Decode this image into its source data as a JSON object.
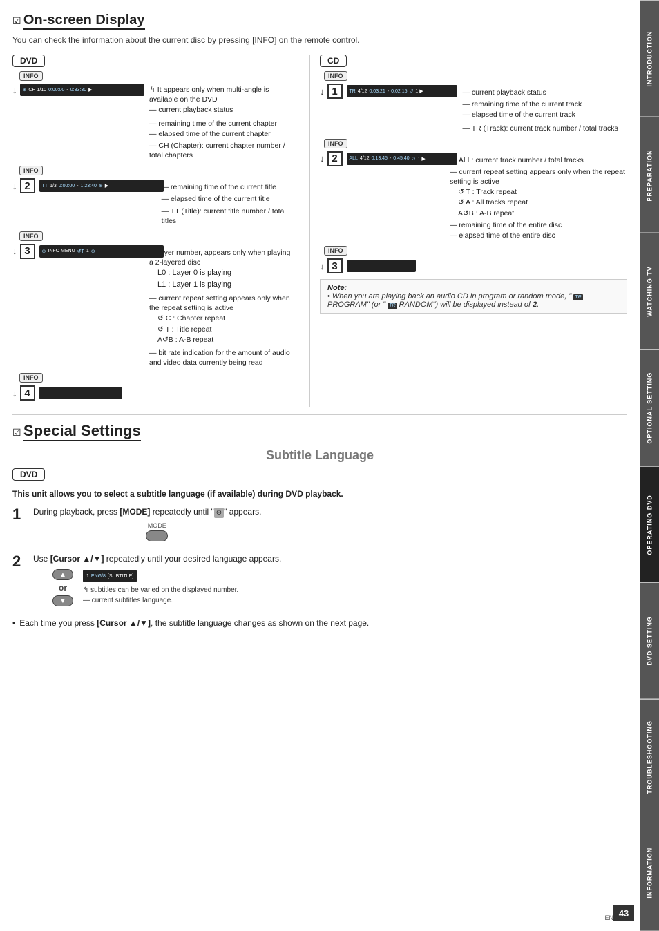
{
  "sidebar": {
    "tabs": [
      {
        "label": "INTRODUCTION",
        "active": false
      },
      {
        "label": "PREPARATION",
        "active": false
      },
      {
        "label": "WATCHING TV",
        "active": false
      },
      {
        "label": "OPTIONAL SETTING",
        "active": false
      },
      {
        "label": "OPERATING DVD",
        "active": true
      },
      {
        "label": "DVD SETTING",
        "active": false
      },
      {
        "label": "TROUBLESHOOTING",
        "active": false
      },
      {
        "label": "INFORMATION",
        "active": false
      }
    ]
  },
  "osd_section": {
    "title": "On-screen Display",
    "checkbox": "☑",
    "subtitle": "You can check the information about the current disc by pressing [INFO] on the remote control.",
    "dvd_badge": "DVD",
    "cd_badge": "CD",
    "dvd_display1": "CH 1/10  0:00:00 - 0:33:30",
    "dvd_display2": "TT 1/3   0:00:00 - 1:23:40",
    "dvd_display3": "INFO MENU   ↺T 1 ⊕",
    "cd_display1": "TR 4/12  0:03:21 - 0:02:15  ↺ 1  ▶",
    "cd_display2": "ALL 4/12  0:13:45 - 0:45:40  ↺ 1  ▶",
    "annotations_dvd": {
      "multi_angle": "It appears only when multi-angle is available on the DVD",
      "playback_status": "current playback status",
      "remaining_current_chapter": "remaining time of the current chapter",
      "elapsed_current_chapter": "elapsed time of the current chapter",
      "ch_chapter": "CH (Chapter): current chapter number / total chapters",
      "remaining_title": "remaining time of the current title",
      "elapsed_title": "elapsed time of the current title",
      "tt_title": "TT (Title): current title number / total titles",
      "layer_number": "layer number, appears only when playing a 2-layered disc",
      "l0": "L0 :  Layer 0 is playing",
      "l1": "L1 :  Layer 1 is playing",
      "repeat_note": "current repeat setting appears only when the repeat setting is active",
      "c_repeat": "↺ C :  Chapter repeat",
      "t_repeat": "↺ T :  Title repeat",
      "ab_repeat": "A↺B :  A-B repeat",
      "bitrate": "bit rate indication for the amount of audio and video data currently being read"
    },
    "annotations_cd": {
      "playback_status": "current playback status",
      "remaining_track": "remaining time of the current track",
      "elapsed_track": "elapsed time of the current track",
      "tr_track": "TR (Track): current track number / total tracks",
      "all_track": "ALL: current track number / total tracks",
      "repeat_active": "current repeat setting appears only when the repeat setting is active",
      "t_repeat": "↺ T :  Track repeat",
      "a_repeat": "↺ A :  All tracks repeat",
      "ab_repeat": "A↺B :  A-B repeat",
      "remaining_disc": "remaining time of the entire disc",
      "elapsed_disc": "elapsed time of the entire disc"
    },
    "note": {
      "title": "Note:",
      "text": "When you are playing back an audio CD in program or random mode, \" PROGRAM\" (or \" RANDOM\") will be displayed instead of 2."
    }
  },
  "special_settings": {
    "title": "Special Settings",
    "checkbox": "☑",
    "subtitle_language": {
      "heading": "Subtitle Language",
      "dvd_badge": "DVD",
      "description": "This unit allows you to select a subtitle language (if available) during DVD playback.",
      "step1": {
        "num": "1",
        "text": "During playback, press [MODE] repeatedly until \" \" appears.",
        "mode_label": "MODE"
      },
      "step2": {
        "num": "2",
        "text": "Use [Cursor ▲/▼] repeatedly until your desired language appears.",
        "display_content": "1 ENG/8  [SUBTITLE]",
        "annotation1": "subtitles can be varied on the displayed number.",
        "annotation2": "current subtitles language."
      },
      "bullet": "Each time you press [Cursor ▲/▼], the subtitle language changes as shown on the next page."
    }
  },
  "page": {
    "number": "43",
    "lang": "EN"
  }
}
